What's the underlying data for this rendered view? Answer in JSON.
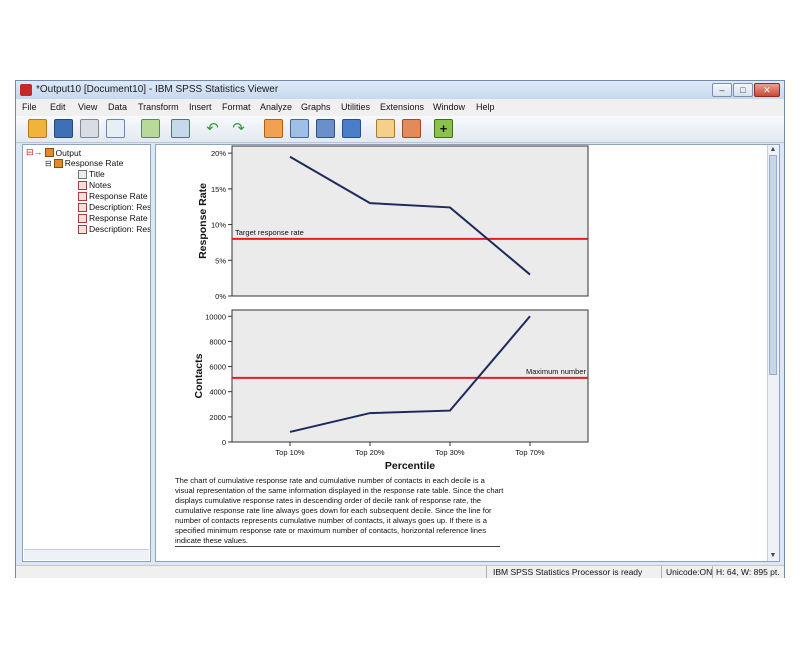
{
  "window": {
    "title": "*Output10 [Document10] - IBM SPSS Statistics Viewer"
  },
  "menu": [
    "File",
    "Edit",
    "View",
    "Data",
    "Transform",
    "Insert",
    "Format",
    "Analyze",
    "Graphs",
    "Utilities",
    "Extensions",
    "Window",
    "Help"
  ],
  "tree": {
    "root": "Output",
    "group": "Response Rate",
    "children": [
      "Title",
      "Notes",
      "Response Rate",
      "Description: Resp",
      "Response Rate C",
      "Description: Resp"
    ]
  },
  "status": {
    "processor": "IBM SPSS Statistics Processor is ready",
    "unicode": "Unicode:ON",
    "size": "H: 64, W: 895 pt."
  },
  "colors": {
    "line": "#1f2a5c",
    "reference": "#e02020",
    "plot_bg": "#ebebeb"
  },
  "chart_data": [
    {
      "type": "line",
      "ylabel": "Response Rate",
      "categories": [
        "Top 10%",
        "Top 20%",
        "Top 30%",
        "Top 70%"
      ],
      "values": [
        19.5,
        13.0,
        12.4,
        3.0
      ],
      "yticks": [
        "0%",
        "5%",
        "10%",
        "15%",
        "20%"
      ],
      "ylim": [
        0,
        21
      ],
      "reference_line": {
        "value": 8.0,
        "label": "Target response rate"
      }
    },
    {
      "type": "line",
      "xlabel": "Percentile",
      "ylabel": "Contacts",
      "categories": [
        "Top 10%",
        "Top 20%",
        "Top 30%",
        "Top 70%"
      ],
      "values": [
        800,
        2300,
        2500,
        10000
      ],
      "yticks": [
        "0",
        "2000",
        "4000",
        "6000",
        "8000",
        "10000"
      ],
      "ylim": [
        0,
        10500
      ],
      "reference_line": {
        "value": 5100,
        "label": "Maximum number"
      }
    }
  ],
  "description": "The chart of cumulative response rate and cumulative number of contacts in each decile is a visual representation of the same information displayed in the response rate table. Since the chart displays cumulative response rates in descending order of decile rank of response rate, the cumulative response rate line always goes down for each subsequent decile. Since the line for number of contacts represents cumulative number of contacts, it always goes up. If there is a specified minimum response rate or maximum number of contacts, horizontal reference lines indicate these values."
}
